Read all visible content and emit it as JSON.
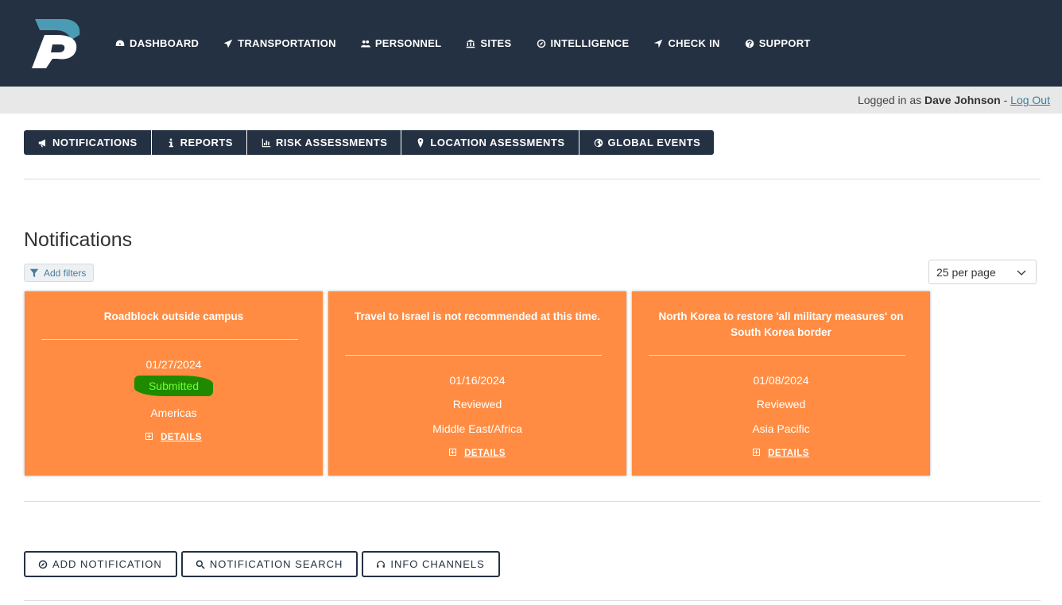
{
  "nav": {
    "items": [
      {
        "label": "DASHBOARD",
        "icon": "dashboard-icon"
      },
      {
        "label": "TRANSPORTATION",
        "icon": "plane-icon"
      },
      {
        "label": "PERSONNEL",
        "icon": "users-icon"
      },
      {
        "label": "SITES",
        "icon": "building-icon"
      },
      {
        "label": "INTELLIGENCE",
        "icon": "compass-icon"
      },
      {
        "label": "CHECK IN",
        "icon": "location-arrow-icon"
      },
      {
        "label": "SUPPORT",
        "icon": "question-icon"
      }
    ]
  },
  "login": {
    "prefix": "Logged in as",
    "user": "Dave Johnson",
    "separator": "-",
    "logout": "Log Out"
  },
  "tabs": [
    {
      "label": "NOTIFICATIONS",
      "icon": "bullhorn-icon"
    },
    {
      "label": "REPORTS",
      "icon": "info-icon"
    },
    {
      "label": "RISK ASSESSMENTS",
      "icon": "bar-chart-icon"
    },
    {
      "label": "LOCATION ASESSMENTS",
      "icon": "map-marker-icon"
    },
    {
      "label": "GLOBAL EVENTS",
      "icon": "globe-icon"
    }
  ],
  "page": {
    "title": "Notifications",
    "filter_label": "Add filters",
    "per_page": "25 per page"
  },
  "cards": [
    {
      "title": "Roadblock outside campus",
      "date": "01/27/2024",
      "status": "Submitted",
      "region": "Americas",
      "details": "DETAILS"
    },
    {
      "title": "Travel to Israel is not recommended at this time.",
      "date": "01/16/2024",
      "status": "Reviewed",
      "region": "Middle East/Africa",
      "details": "DETAILS"
    },
    {
      "title": "North Korea to restore 'all military measures' on South Korea border",
      "date": "01/08/2024",
      "status": "Reviewed",
      "region": "Asia Pacific",
      "details": "DETAILS"
    }
  ],
  "buttons": {
    "add": "ADD NOTIFICATION",
    "search": "NOTIFICATION SEARCH",
    "channels": "INFO CHANNELS"
  },
  "colors": {
    "nav_bg": "#243142",
    "card_bg": "#ff8c42",
    "logo_accent": "#4a9bb3",
    "submitted_highlight": "#1f8a00"
  }
}
